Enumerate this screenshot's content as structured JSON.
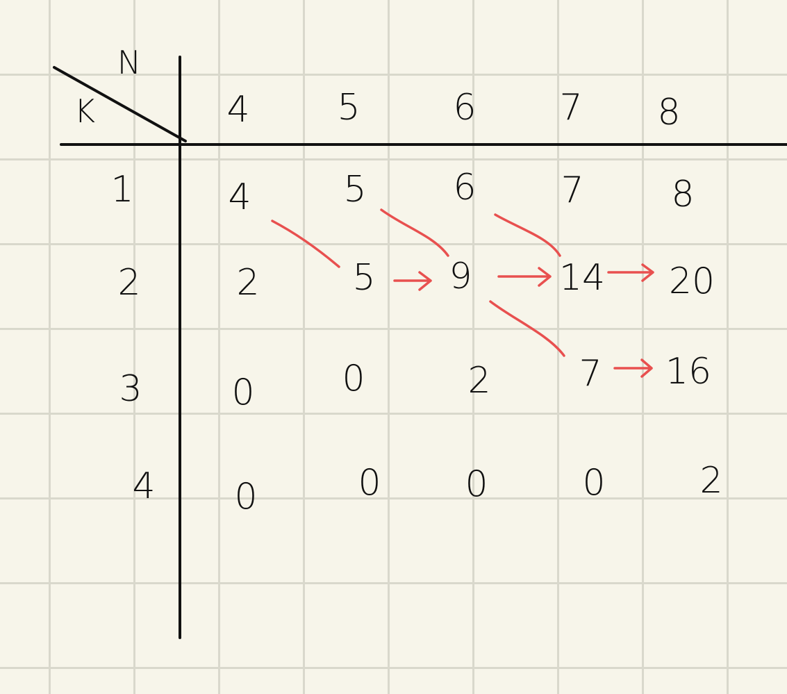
{
  "header": {
    "corner_row_label": "K",
    "corner_col_label": "N",
    "columns": [
      "4",
      "5",
      "6",
      "7",
      "8"
    ]
  },
  "rows": [
    {
      "k": "1",
      "cells": [
        "4",
        "5",
        "6",
        "7",
        "8"
      ]
    },
    {
      "k": "2",
      "cells": [
        "2",
        "5",
        "9",
        "14",
        "20"
      ]
    },
    {
      "k": "3",
      "cells": [
        "0",
        "0",
        "2",
        "7",
        "16"
      ]
    },
    {
      "k": "4",
      "cells": [
        "0",
        "0",
        "0",
        "0",
        "2"
      ]
    }
  ],
  "colors": {
    "ink": "#111111",
    "arrow": "#e8504f",
    "paper": "#f7f5ea",
    "grid": "#d9d8cc"
  }
}
